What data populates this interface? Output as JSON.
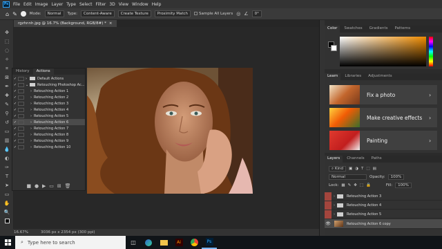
{
  "menu": {
    "app_icon": "Ps",
    "items": [
      "File",
      "Edit",
      "Image",
      "Layer",
      "Type",
      "Select",
      "Filter",
      "3D",
      "View",
      "Window",
      "Help"
    ]
  },
  "options_bar": {
    "mode_label": "Mode:",
    "mode_value": "Normal",
    "type_label": "Type:",
    "type_buttons": [
      "Content-Aware",
      "Create Texture",
      "Proximity Match"
    ],
    "sample_all_layers": "Sample All Layers",
    "angle_value": "0°"
  },
  "document": {
    "tab_title": "rgzhnnh.jpg @ 16.7% (Background, RGB/8#) *",
    "close_glyph": "×"
  },
  "status": {
    "zoom": "16.67%",
    "doc_info": "3036 px x 2354 px (300 ppi)"
  },
  "actions_panel": {
    "tabs": [
      "History",
      "Actions"
    ],
    "rows": [
      {
        "label": "Default Actions",
        "indent": 0,
        "type": "folder"
      },
      {
        "label": "Retouching Photoshop Ac...",
        "indent": 0,
        "type": "folder"
      },
      {
        "label": "Retouching Action 1",
        "indent": 1,
        "type": "action"
      },
      {
        "label": "Retouching Action 2",
        "indent": 1,
        "type": "action"
      },
      {
        "label": "Retouching Action 3",
        "indent": 1,
        "type": "action"
      },
      {
        "label": "Retouching Action 4",
        "indent": 1,
        "type": "action"
      },
      {
        "label": "Retouching Action 5",
        "indent": 1,
        "type": "action"
      },
      {
        "label": "Retouching Action 6",
        "indent": 1,
        "type": "action",
        "selected": true
      },
      {
        "label": "Retouching Action 7",
        "indent": 1,
        "type": "action"
      },
      {
        "label": "Retouching Action 8",
        "indent": 1,
        "type": "action"
      },
      {
        "label": "Retouching Action 9",
        "indent": 1,
        "type": "action"
      },
      {
        "label": "Retouching Action 10",
        "indent": 1,
        "type": "action"
      }
    ],
    "check_glyph": "✓",
    "footer_icons": [
      "stop-icon",
      "record-icon",
      "play-icon",
      "new-set-icon",
      "new-action-icon",
      "delete-icon"
    ]
  },
  "color_panel": {
    "tabs": [
      "Color",
      "Swatches",
      "Gradients",
      "Patterns"
    ],
    "foreground": "#000000",
    "background": "#ffffff"
  },
  "learn_panel": {
    "tabs": [
      "Learn",
      "Libraries",
      "Adjustments"
    ],
    "cards": [
      {
        "title": "Fix a photo",
        "icon": "fix-photo-thumbnail"
      },
      {
        "title": "Make creative effects",
        "icon": "creative-effects-thumbnail"
      },
      {
        "title": "Painting",
        "icon": "painting-thumbnail"
      }
    ],
    "chevron_glyph": "›"
  },
  "layers_panel": {
    "tabs": [
      "Layers",
      "Channels",
      "Paths"
    ],
    "filter_value": "Kind",
    "blend_mode": "Normal",
    "opacity_label": "Opacity:",
    "opacity_value": "100%",
    "lock_label": "Lock:",
    "fill_label": "Fill:",
    "fill_value": "100%",
    "layers": [
      {
        "name": "Retouching Action 3",
        "type": "group"
      },
      {
        "name": "Retouching Action 4",
        "type": "group"
      },
      {
        "name": "Retouching Action 5",
        "type": "group"
      },
      {
        "name": "Retouching Action 6 copy",
        "type": "layer",
        "selected": true
      }
    ]
  },
  "taskbar": {
    "search_placeholder": "Type here to search",
    "apps": [
      "task-view-icon",
      "edge-icon",
      "file-explorer-icon",
      "illustrator-icon",
      "chrome-icon",
      "photoshop-icon"
    ]
  }
}
